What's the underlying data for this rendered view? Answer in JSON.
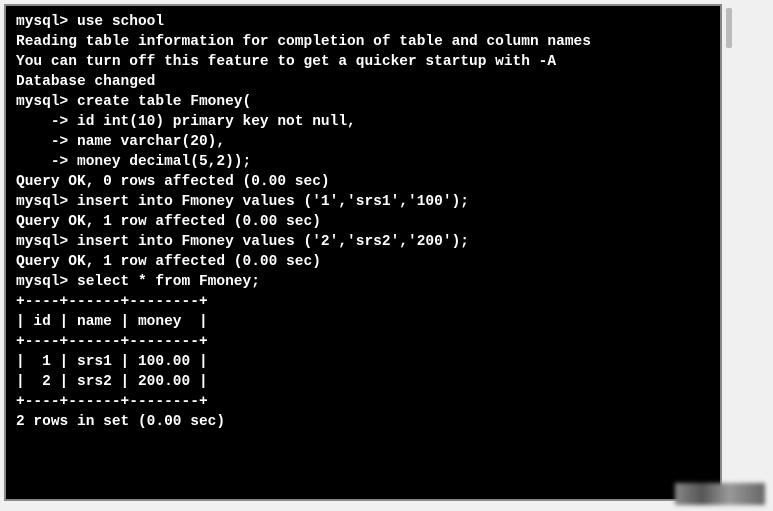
{
  "terminal": {
    "lines": {
      "l0": "mysql> use school",
      "l1": "Reading table information for completion of table and column names",
      "l2": "You can turn off this feature to get a quicker startup with -A",
      "l3": "",
      "l4": "Database changed",
      "l5": "mysql> create table Fmoney(",
      "l6": "    -> id int(10) primary key not null,",
      "l7": "    -> name varchar(20),",
      "l8": "    -> money decimal(5,2));",
      "l9": "Query OK, 0 rows affected (0.00 sec)",
      "l10": "",
      "l11": "mysql> insert into Fmoney values ('1','srs1','100');",
      "l12": "Query OK, 1 row affected (0.00 sec)",
      "l13": "",
      "l14": "mysql> insert into Fmoney values ('2','srs2','200');",
      "l15": "Query OK, 1 row affected (0.00 sec)",
      "l16": "",
      "l17": "mysql> select * from Fmoney;",
      "l18": "+----+------+--------+",
      "l19": "| id | name | money  |",
      "l20": "+----+------+--------+",
      "l21": "|  1 | srs1 | 100.00 |",
      "l22": "|  2 | srs2 | 200.00 |",
      "l23": "+----+------+--------+",
      "l24": "2 rows in set (0.00 sec)"
    }
  },
  "mysql_session": {
    "database": "school",
    "commands": [
      "use school",
      "create table Fmoney( id int(10) primary key not null, name varchar(20), money decimal(5,2));",
      "insert into Fmoney values ('1','srs1','100');",
      "insert into Fmoney values ('2','srs2','200');",
      "select * from Fmoney;"
    ],
    "table": {
      "name": "Fmoney",
      "columns": [
        "id",
        "name",
        "money"
      ],
      "rows": [
        {
          "id": 1,
          "name": "srs1",
          "money": "100.00"
        },
        {
          "id": 2,
          "name": "srs2",
          "money": "200.00"
        }
      ],
      "row_count": 2,
      "elapsed": "0.00 sec"
    }
  }
}
